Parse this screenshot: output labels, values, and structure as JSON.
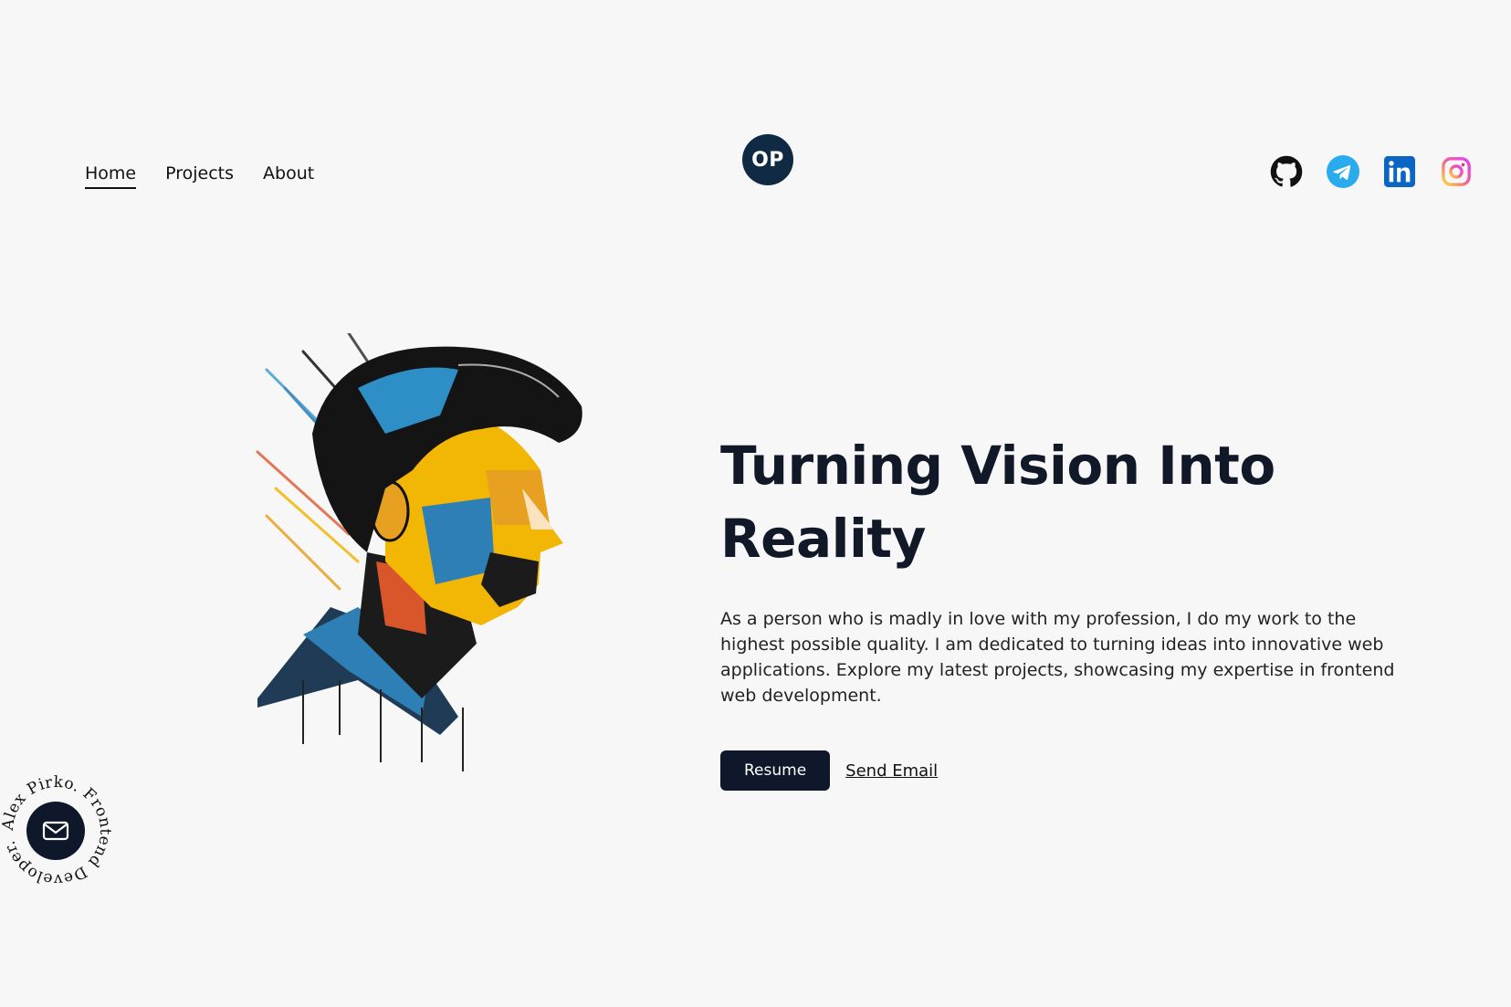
{
  "nav": {
    "items": [
      {
        "label": "Home",
        "active": true
      },
      {
        "label": "Projects",
        "active": false
      },
      {
        "label": "About",
        "active": false
      }
    ]
  },
  "logo": {
    "text": "OP",
    "color": "#102a43"
  },
  "social": [
    {
      "name": "github-icon",
      "color": "#111111"
    },
    {
      "name": "telegram-icon",
      "color": "#2aabee"
    },
    {
      "name": "linkedin-icon",
      "color": "#0a66c2"
    },
    {
      "name": "instagram-icon",
      "color": "#e1306c"
    }
  ],
  "hero": {
    "title": "Turning Vision Into Reality",
    "description": "As a person who is madly in love with my profession, I do my work to the highest possible quality. I am dedicated to turning ideas into innovative web applications. Explore my latest projects, showcasing my expertise in frontend web development.",
    "resume_label": "Resume",
    "email_label": "Send Email"
  },
  "badge": {
    "circle_text": "Alex Pirko. Frontend Developer.",
    "icon": "mail-icon"
  },
  "colors": {
    "background": "#f7f7f7",
    "primary": "#0f172a"
  }
}
